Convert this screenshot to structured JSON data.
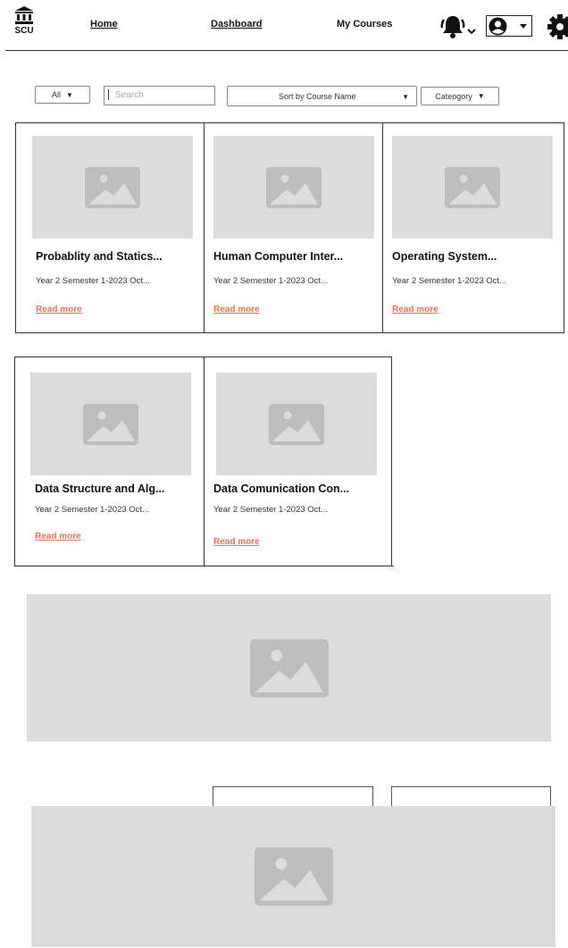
{
  "header": {
    "logo_text": "SCU",
    "nav": {
      "home": "Home",
      "dashboard": "Dashboard",
      "my_courses": "My Courses"
    },
    "icons": [
      "institution-icon",
      "bell-icon",
      "chevron-down-icon",
      "user-circle-icon",
      "caret-down-icon",
      "gear-icon"
    ]
  },
  "filters": {
    "all_label": "All",
    "search_placeholder": "Search",
    "sort_label": "Sort by Course Name",
    "category_label": "Cateogory"
  },
  "courses": [
    {
      "title": "Probablity and Statics...",
      "meta": "Year 2 Semester 1-2023 Oct...",
      "link": "Read more"
    },
    {
      "title": "Human Computer Inter...",
      "meta": "Year 2 Semester 1-2023 Oct...",
      "link": "Read more"
    },
    {
      "title": "Operating System...",
      "meta": "Year 2 Semester 1-2023 Oct...",
      "link": "Read more"
    },
    {
      "title": "Data Structure and Alg...",
      "meta": "Year 2 Semester 1-2023 Oct...",
      "link": "Read more"
    },
    {
      "title": "Data Comunication Con...",
      "meta": "Year 2 Semester 1-2023 Oct...",
      "link": "Read more"
    }
  ],
  "colors": {
    "link": "#e8735a",
    "placeholder_bg": "#dcdcdc",
    "image_icon": "#bdbdbd"
  }
}
